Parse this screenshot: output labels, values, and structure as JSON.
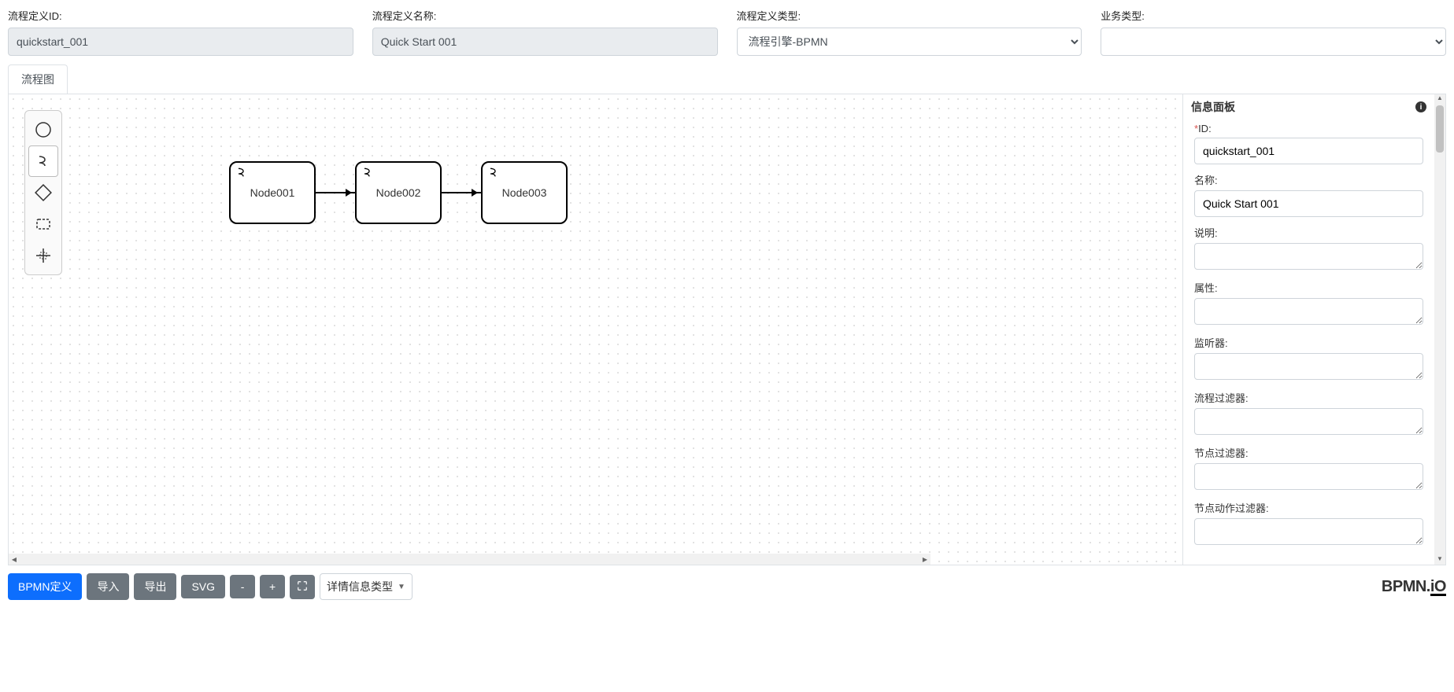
{
  "header": {
    "fields": {
      "id": {
        "label": "流程定义ID:",
        "value": "quickstart_001"
      },
      "name": {
        "label": "流程定义名称:",
        "value": "Quick Start 001"
      },
      "type": {
        "label": "流程定义类型:",
        "value": "流程引擎-BPMN"
      },
      "biz": {
        "label": "业务类型:",
        "value": ""
      }
    }
  },
  "tabs": {
    "diagram": "流程图"
  },
  "nodes": [
    {
      "label": "Node001"
    },
    {
      "label": "Node002"
    },
    {
      "label": "Node003"
    }
  ],
  "panel": {
    "title": "信息面板",
    "fields": {
      "id": {
        "label": "ID:",
        "required": "*",
        "value": "quickstart_001"
      },
      "name": {
        "label": "名称:",
        "value": "Quick Start 001"
      },
      "desc": {
        "label": "说明:",
        "value": ""
      },
      "attr": {
        "label": "属性:",
        "value": ""
      },
      "listener": {
        "label": "监听器:",
        "value": ""
      },
      "flowFilter": {
        "label": "流程过滤器:",
        "value": ""
      },
      "nodeFilter": {
        "label": "节点过滤器:",
        "value": ""
      },
      "nodeActionFilter": {
        "label": "节点动作过滤器:",
        "value": ""
      }
    }
  },
  "footer": {
    "bpmn": "BPMN定义",
    "import": "导入",
    "export": "导出",
    "svg": "SVG",
    "zoomOut": "-",
    "zoomIn": "+",
    "detail": "详情信息类型",
    "logo": "BPMN.iO"
  }
}
